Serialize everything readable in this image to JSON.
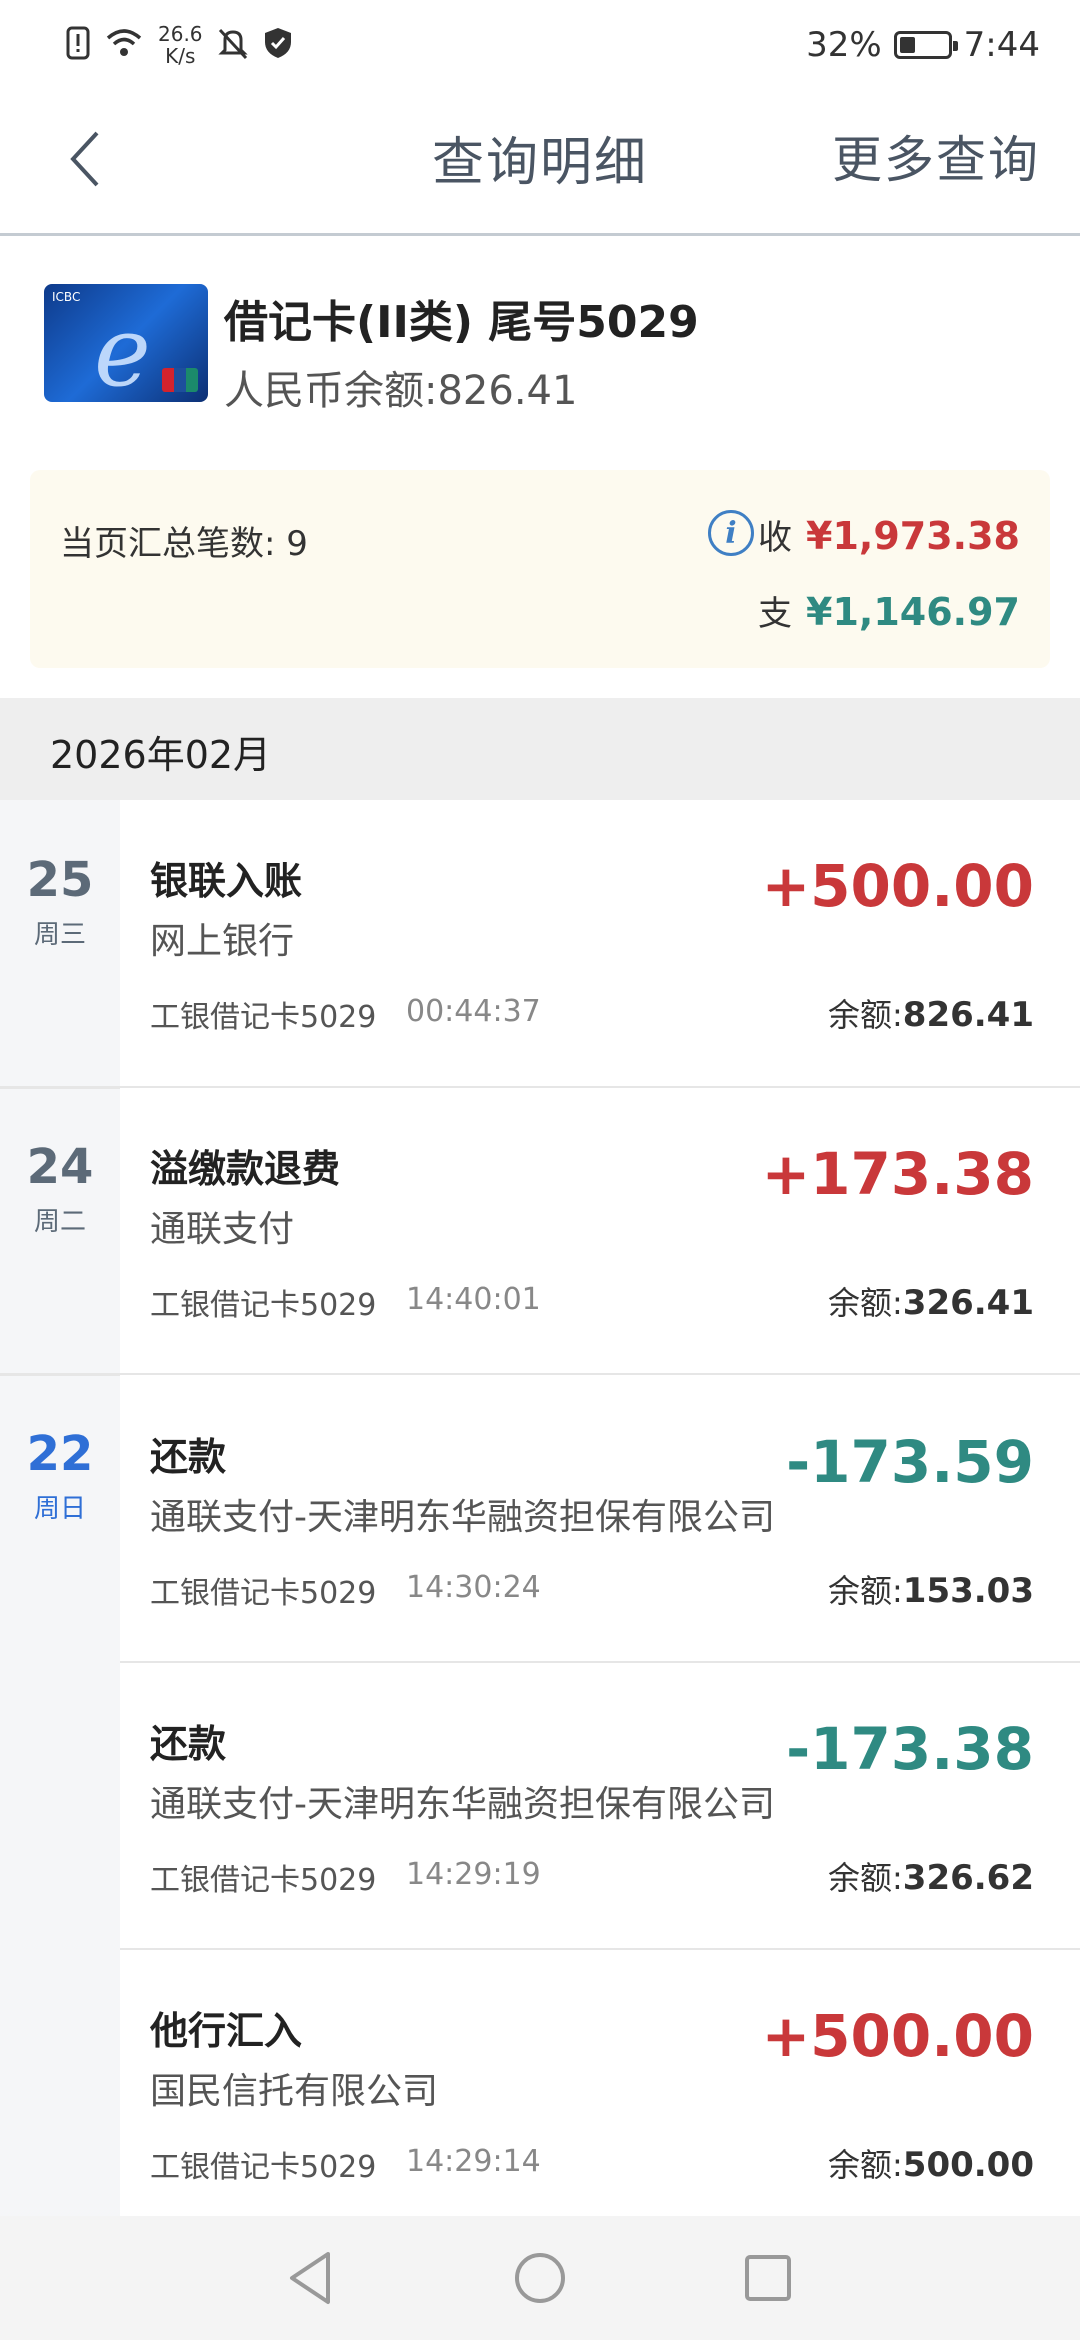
{
  "status_bar": {
    "net_speed_value": "26.6",
    "net_speed_unit": "K/s",
    "battery_percent": "32%",
    "battery_level": 0.32,
    "time": "7:44",
    "icons": [
      "alert-icon",
      "wifi-icon",
      "mute-icon",
      "shield-icon",
      "battery-icon"
    ]
  },
  "header": {
    "title": "查询明细",
    "more": "更多查询"
  },
  "card": {
    "title": "借记卡(II类) 尾号5029",
    "balance": "人民币余额:826.41"
  },
  "summary": {
    "count_label": "当页汇总笔数: 9",
    "income_label": "收",
    "income_amount": "¥1,973.38",
    "expense_label": "支",
    "expense_amount": "¥1,146.97"
  },
  "month": "2026年02月",
  "dates": [
    {
      "day": "25",
      "weekday": "周三"
    },
    {
      "day": "24",
      "weekday": "周二"
    },
    {
      "day": "22",
      "weekday": "周日"
    }
  ],
  "transactions": [
    {
      "title": "银联入账",
      "sub": "网上银行",
      "card": "工银借记卡5029",
      "time": "00:44:37",
      "amount": "+500.00",
      "balance_label": "余额:",
      "balance": "826.41",
      "type": "in"
    },
    {
      "title": "溢缴款退费",
      "sub": "通联支付",
      "card": "工银借记卡5029",
      "time": "14:40:01",
      "amount": "+173.38",
      "balance_label": "余额:",
      "balance": "326.41",
      "type": "in"
    },
    {
      "title": "还款",
      "sub": "通联支付-天津明东华融资担保有限公司",
      "card": "工银借记卡5029",
      "time": "14:30:24",
      "amount": "-173.59",
      "balance_label": "余额:",
      "balance": "153.03",
      "type": "out"
    },
    {
      "title": "还款",
      "sub": "通联支付-天津明东华融资担保有限公司",
      "card": "工银借记卡5029",
      "time": "14:29:19",
      "amount": "-173.38",
      "balance_label": "余额:",
      "balance": "326.62",
      "type": "out"
    },
    {
      "title": "他行汇入",
      "sub": "国民信托有限公司",
      "card": "工银借记卡5029",
      "time": "14:29:14",
      "amount": "+500.00",
      "balance_label": "余额:",
      "balance": "500.00",
      "type": "in"
    }
  ],
  "colors": {
    "income": "#c9383a",
    "expense": "#2f8a82",
    "today_accent": "#2f6fd6"
  }
}
